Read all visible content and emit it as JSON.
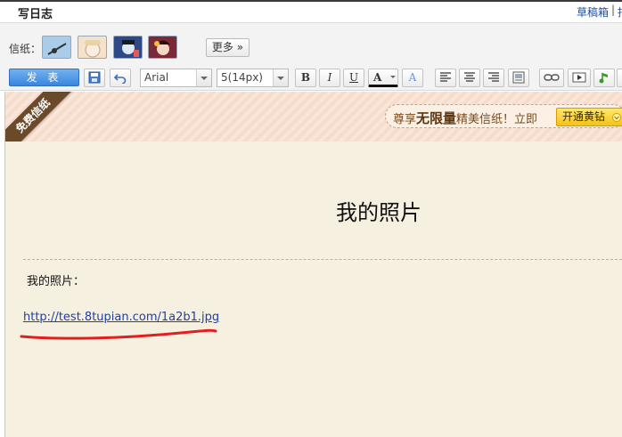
{
  "header": {
    "title": "写日志",
    "drafts_label": "草稿箱",
    "separator": "|",
    "extra_label": "指"
  },
  "stationery": {
    "label": "信纸：",
    "more_label": "更多 »",
    "thumbnail_colors": [
      "#a9cde8",
      "#f4e2cc",
      "#2e4a86",
      "#7b2838"
    ]
  },
  "toolbar": {
    "publish_label": "发 表",
    "font_family": "Arial",
    "font_size": "5(14px)",
    "bold": "B",
    "italic": "I",
    "underline": "U",
    "font_color": "A",
    "highlight": "A"
  },
  "banner": {
    "ribbon_text": "免费信纸",
    "promo_prefix": "尊享",
    "promo_bold": "无限量",
    "promo_suffix": "精美信纸！立即",
    "promo_button": "开通黄钻"
  },
  "document": {
    "title": "我的照片",
    "body_label": "我的照片：",
    "link_text": "http://test.8tupian.com/1a2b1.jpg"
  },
  "colors": {
    "editor_background": "#f5f0df",
    "annotation_underline": "#e02020",
    "link": "#1f3fa3"
  }
}
